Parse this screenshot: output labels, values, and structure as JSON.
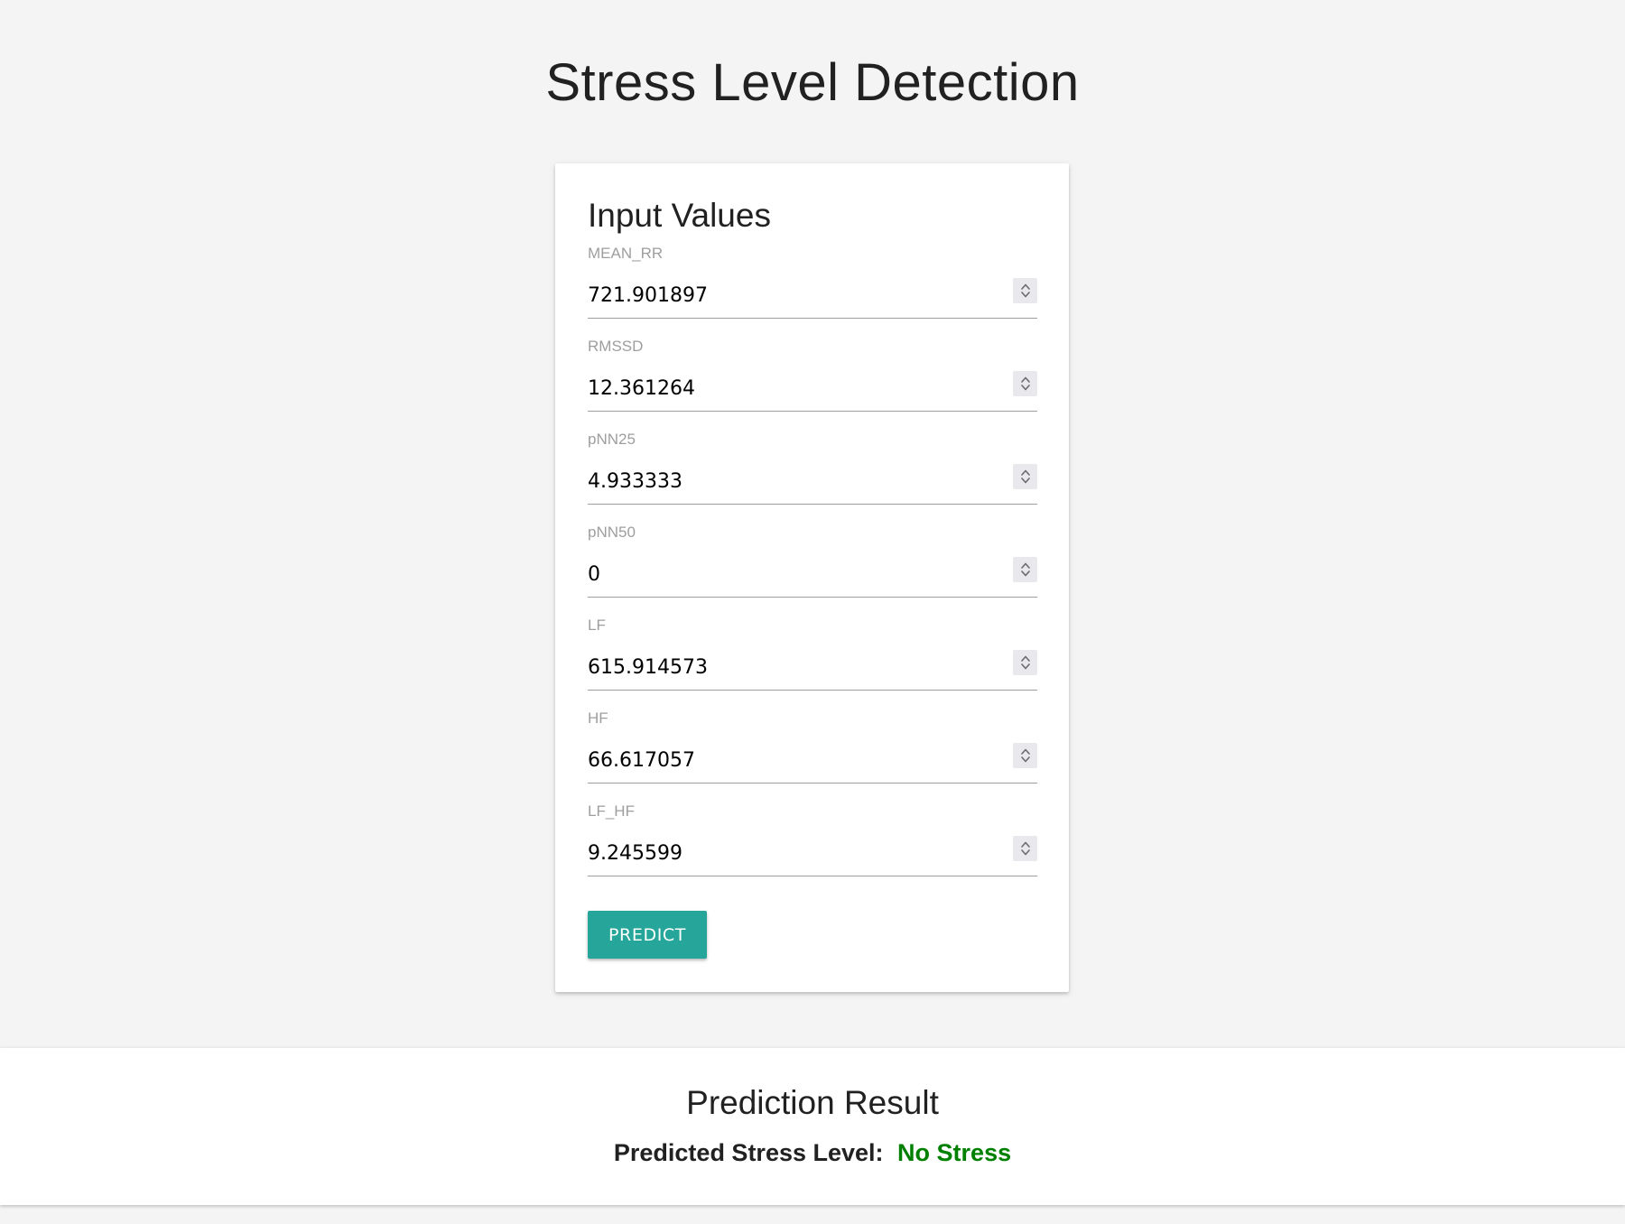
{
  "page": {
    "title": "Stress Level Detection"
  },
  "form": {
    "title": "Input Values",
    "fields": [
      {
        "label": "MEAN_RR",
        "value": "721.901897"
      },
      {
        "label": "RMSSD",
        "value": "12.361264"
      },
      {
        "label": "pNN25",
        "value": "4.933333"
      },
      {
        "label": "pNN50",
        "value": "0"
      },
      {
        "label": "LF",
        "value": "615.914573"
      },
      {
        "label": "HF",
        "value": "66.617057"
      },
      {
        "label": "LF_HF",
        "value": "9.245599"
      }
    ],
    "submit_label": "PREDICT"
  },
  "result": {
    "title": "Prediction Result",
    "label": "Predicted Stress Level:",
    "value": "No Stress"
  },
  "colors": {
    "background": "#f4f4f4",
    "button": "#26a69a",
    "result_value": "#008000"
  },
  "icons": {
    "spinner": "chevron-up-down-icon"
  }
}
